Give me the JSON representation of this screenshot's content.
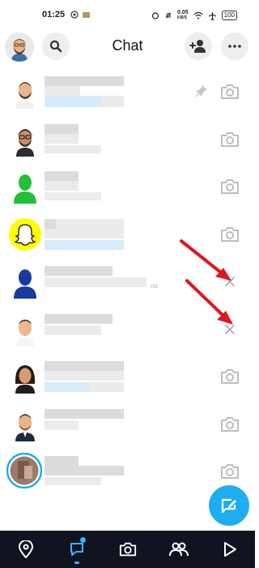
{
  "status_bar": {
    "time": "01:25",
    "network_speed_value": "0.05",
    "network_speed_unit": "KB/S",
    "battery": "100"
  },
  "header": {
    "title": "Chat"
  },
  "chats": [
    {
      "avatar": "bitmoji-man-beard",
      "action": "camera-icon",
      "pinned": true
    },
    {
      "avatar": "bitmoji-man-glasses",
      "action": "camera-icon",
      "pinned": false
    },
    {
      "avatar": "green-silhouette",
      "action": "camera-icon",
      "pinned": false
    },
    {
      "avatar": "snapchat-ghost",
      "action": "camera-icon",
      "pinned": false
    },
    {
      "avatar": "blue-silhouette",
      "action": "close-icon",
      "pinned": false,
      "extra_text": "no"
    },
    {
      "avatar": "bitmoji-man-short-hair",
      "action": "close-icon",
      "pinned": false
    },
    {
      "avatar": "bitmoji-woman",
      "action": "camera-icon",
      "pinned": false
    },
    {
      "avatar": "bitmoji-man-suit",
      "action": "camera-icon",
      "pinned": false
    },
    {
      "avatar": "photo-story-ring",
      "action": "camera-icon",
      "pinned": false
    }
  ],
  "colors": {
    "accent": "#1eaef0",
    "nav_background": "#0f1420",
    "annotation_arrow": "#e0161e",
    "snapchat_yellow": "#fffc00"
  },
  "bottom_nav": [
    "map-icon",
    "chat-icon",
    "camera-icon",
    "friends-icon",
    "spotlight-icon"
  ]
}
